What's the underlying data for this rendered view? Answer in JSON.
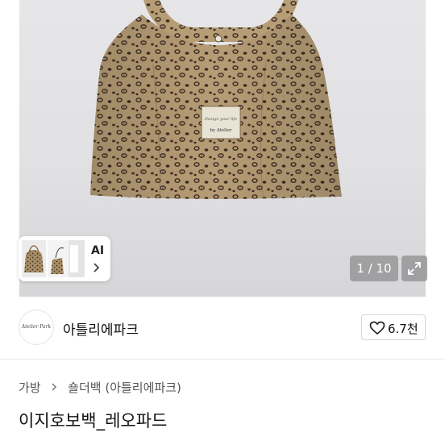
{
  "gallery": {
    "ai_label": "AI",
    "counter": "1 / 10",
    "icons": [
      "chevron-right-icon",
      "expand-icon"
    ]
  },
  "store": {
    "avatar_text": "Atelier Park",
    "name": "아틀리에파크",
    "favorites_count": "6.7천",
    "icons": [
      "heart-outline-icon"
    ]
  },
  "breadcrumb": {
    "items": [
      "가방",
      "숄더백 (아틀리에파크)"
    ],
    "separator_icon": "chevron-right-icon"
  },
  "product": {
    "title": "이지호보백_레오파드",
    "bag_tag_line1": "Design your life",
    "bag_tag_line2": "by Atelier"
  },
  "colors": {
    "photo_background": "#e1e1e3",
    "overlay": "#969698",
    "text": "#111111",
    "leopard_base": "#b59b74",
    "leopard_spot": "#3a2d22"
  }
}
